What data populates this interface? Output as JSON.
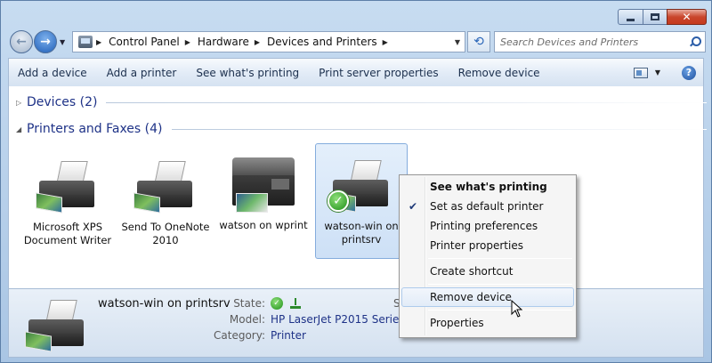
{
  "window": {
    "caption_buttons": {
      "minimize_icon": "minimize-icon",
      "maximize_icon": "maximize-icon",
      "close_icon": "close-icon"
    }
  },
  "nav": {
    "back_icon": "back-arrow-icon",
    "forward_icon": "forward-arrow-icon",
    "breadcrumb": [
      "Control Panel",
      "Hardware",
      "Devices and Printers"
    ],
    "search_placeholder": "Search Devices and Printers"
  },
  "toolbar": {
    "items": [
      "Add a device",
      "Add a printer",
      "See what's printing",
      "Print server properties",
      "Remove device"
    ]
  },
  "groups": {
    "devices": {
      "label": "Devices (2)",
      "expanded": false
    },
    "printers": {
      "label": "Printers and Faxes (4)",
      "expanded": true
    }
  },
  "printers": [
    {
      "label": "Microsoft XPS Document Writer",
      "icon": "printer-icon",
      "selected": false,
      "default": false
    },
    {
      "label": "Send To OneNote 2010",
      "icon": "printer-icon",
      "selected": false,
      "default": false
    },
    {
      "label": "watson on wprint",
      "icon": "fax-printer-icon",
      "selected": false,
      "default": false
    },
    {
      "label": "watson-win on printsrv",
      "icon": "printer-icon",
      "selected": true,
      "default": true
    }
  ],
  "details": {
    "name": "watson-win on printsrv",
    "state_label": "State:",
    "model_label": "Model:",
    "model_value": "HP LaserJet P2015 Serie...",
    "category_label": "Category:",
    "category_value": "Printer",
    "partial_label": "S"
  },
  "context_menu": {
    "items": [
      {
        "label": "See what's printing",
        "bold": true,
        "checked": false,
        "hover": false
      },
      {
        "label": "Set as default printer",
        "bold": false,
        "checked": true,
        "hover": false
      },
      {
        "label": "Printing preferences",
        "bold": false,
        "checked": false,
        "hover": false
      },
      {
        "label": "Printer properties",
        "bold": false,
        "checked": false,
        "hover": false
      },
      {
        "separator": true
      },
      {
        "label": "Create shortcut",
        "bold": false,
        "checked": false,
        "hover": false
      },
      {
        "separator": true
      },
      {
        "label": "Remove device",
        "bold": false,
        "checked": false,
        "hover": true
      },
      {
        "separator": true
      },
      {
        "label": "Properties",
        "bold": false,
        "checked": false,
        "hover": false
      }
    ]
  },
  "colors": {
    "group_heading": "#1e3287",
    "selection_bg": "#cde0f6",
    "default_check": "#1e8f18"
  }
}
